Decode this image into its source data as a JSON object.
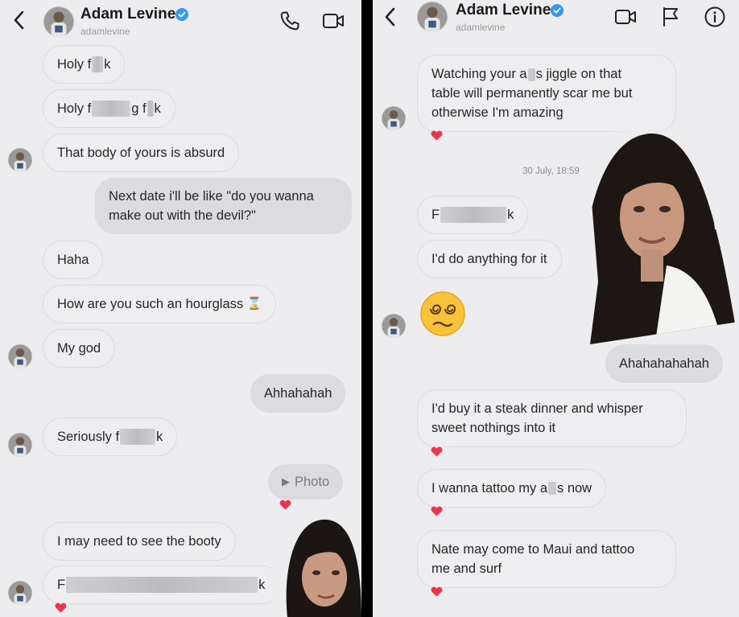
{
  "left": {
    "header": {
      "name": "Adam Levine",
      "handle": "adamlevine"
    },
    "messages": {
      "m1": {
        "pre": "Holy f",
        "post": "k"
      },
      "m2": {
        "pre": "Holy f",
        "mid": "g f",
        "post": "k"
      },
      "m3": "That body of yours is absurd",
      "m4": {
        "l1": "Next date i'll be like \"do you wanna",
        "l2": "make out with the devil?\""
      },
      "m5": "Haha",
      "m6": {
        "text": "How are you such an hourglass",
        "emoji": "⌛"
      },
      "m7": "My god",
      "m8": "Ahhahahah",
      "m9": {
        "pre": "Seriously f",
        "post": "k"
      },
      "m10": {
        "icon": "▶",
        "label": "Photo"
      },
      "m11": "I may need to see the booty",
      "m12": {
        "pre": "F",
        "post": "k"
      }
    }
  },
  "right": {
    "header": {
      "name": "Adam Levine",
      "handle": "adamlevine"
    },
    "messages": {
      "m1": {
        "l1_pre": "Watching your a",
        "l1_post": "s jiggle on that",
        "l2": "table will permanently scar me but",
        "l3": "otherwise I'm amazing"
      },
      "timestamp": "30 July, 18:59",
      "m2": {
        "pre": "F",
        "post": "k"
      },
      "m3": "I'd do anything for it",
      "m4": "Ahahahahahah",
      "m5": {
        "l1": "I'd buy it a steak dinner and whisper",
        "l2": "sweet nothings into it"
      },
      "m6": {
        "pre": "I wanna tattoo my a",
        "post": "s now"
      },
      "m7": {
        "l1": "Nate may come to Maui and tattoo",
        "l2": "me and surf"
      }
    }
  },
  "colors": {
    "background": "#ededf0",
    "bubble_in": "#eeeef1",
    "bubble_out": "#dcdce0",
    "verified": "#3897f0",
    "heart": "#e8364b"
  },
  "icons": [
    "back-icon",
    "verified-icon",
    "phone-icon",
    "video-icon",
    "flag-icon",
    "info-icon",
    "heart-icon",
    "hourglass-icon",
    "dizzy-face-icon"
  ]
}
